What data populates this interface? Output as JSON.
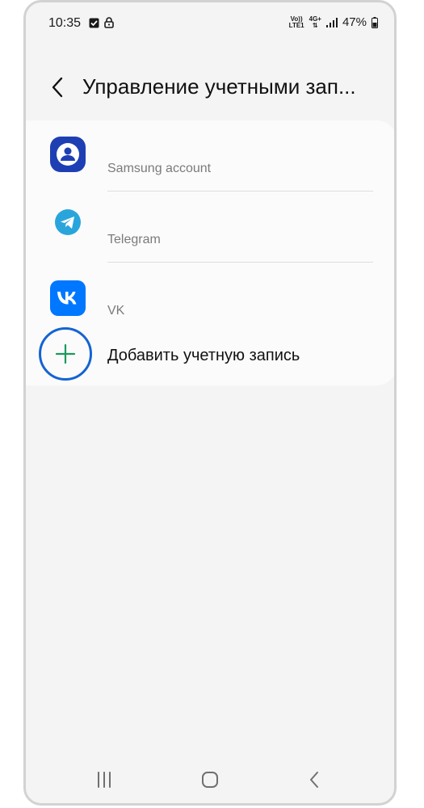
{
  "status_bar": {
    "time": "10:35",
    "network_top": "Vo))",
    "network_bottom": "LTE1",
    "data_type": "4G+",
    "battery": "47%"
  },
  "header": {
    "title": "Управление учетными зап..."
  },
  "accounts": [
    {
      "label": "Samsung account",
      "icon": "samsung-account-icon"
    },
    {
      "label": "Telegram",
      "icon": "telegram-icon"
    },
    {
      "label": "VK",
      "icon": "vk-icon"
    }
  ],
  "add_account": {
    "label": "Добавить учетную запись",
    "icon": "plus-icon"
  },
  "nav_bar": {
    "recents_icon": "recents-icon",
    "home_icon": "home-icon",
    "back_icon": "back-icon"
  },
  "colors": {
    "background": "#f4f4f4",
    "card": "#fbfbfb",
    "highlight_ring": "#1464d2",
    "plus": "#1a9a5a",
    "samsung_blue": "#1e3fb4",
    "telegram_blue": "#2aa5dc",
    "vk_blue": "#0077ff"
  }
}
